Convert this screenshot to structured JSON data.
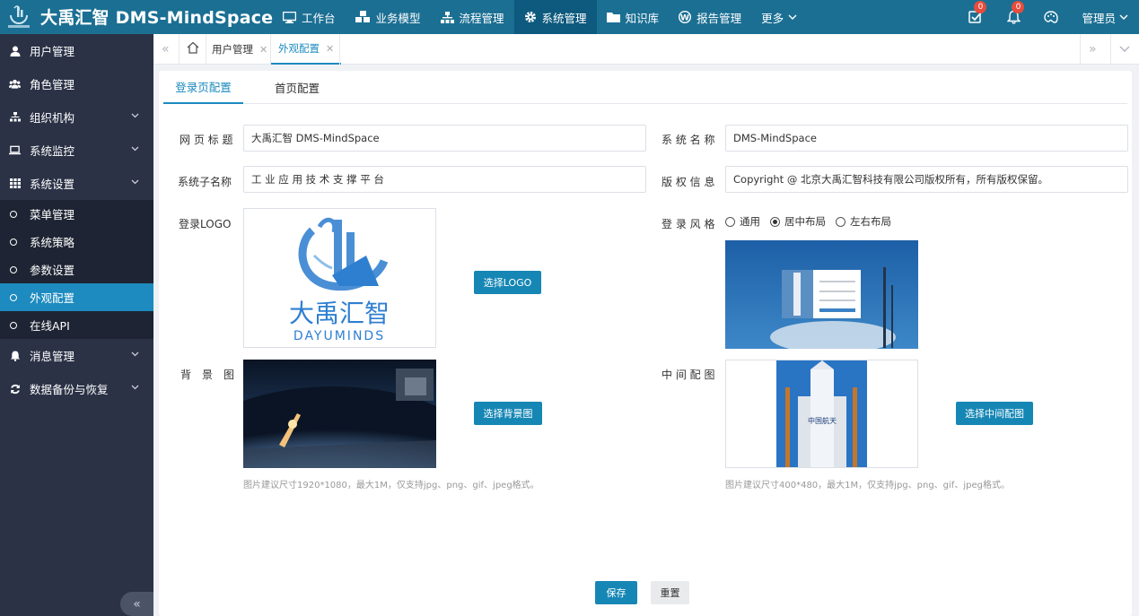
{
  "app": {
    "title": "大禹汇智 DMS-MindSpace",
    "logo_text": "大禹汇智"
  },
  "nav": [
    {
      "label": "工作台",
      "icon": "monitor-icon"
    },
    {
      "label": "业务模型",
      "icon": "cubes-icon"
    },
    {
      "label": "流程管理",
      "icon": "sitemap-icon"
    },
    {
      "label": "系统管理",
      "icon": "gear-icon",
      "active": true
    },
    {
      "label": "知识库",
      "icon": "folder-icon"
    },
    {
      "label": "报告管理",
      "icon": "wordpress-icon"
    },
    {
      "label": "更多",
      "icon": "chevron-down-icon"
    }
  ],
  "topbar": {
    "tasks_badge": "0",
    "notify_badge": "0",
    "user": "管理员"
  },
  "sidebar": {
    "items": [
      {
        "label": "用户管理",
        "icon": "user-icon"
      },
      {
        "label": "角色管理",
        "icon": "users-icon"
      },
      {
        "label": "组织机构",
        "icon": "sitemap-icon",
        "expandable": true
      },
      {
        "label": "系统监控",
        "icon": "laptop-icon",
        "expandable": true
      },
      {
        "label": "系统设置",
        "icon": "grid-icon",
        "expandable": true
      }
    ],
    "sub": [
      {
        "label": "菜单管理"
      },
      {
        "label": "系统策略"
      },
      {
        "label": "参数设置"
      },
      {
        "label": "外观配置",
        "active": true
      },
      {
        "label": "在线API"
      }
    ],
    "after": [
      {
        "label": "消息管理",
        "icon": "bell-icon",
        "expandable": true
      },
      {
        "label": "数据备份与恢复",
        "icon": "refresh-icon",
        "expandable": true
      }
    ],
    "collapse": "«"
  },
  "tabs": [
    {
      "label": "用户管理"
    },
    {
      "label": "外观配置",
      "active": true
    }
  ],
  "subtabs": [
    {
      "label": "登录页配置",
      "active": true
    },
    {
      "label": "首页配置"
    }
  ],
  "form": {
    "web_title_label": "网 页 标 题",
    "web_title_value": "大禹汇智 DMS-MindSpace",
    "sys_name_label": "系 统 名 称",
    "sys_name_value": "DMS-MindSpace",
    "sub_name_label": "系统子名称",
    "sub_name_value": "工 业 应 用 技 术 支 撑 平 台",
    "copyright_label": "版 权 信 息",
    "copyright_value": "Copyright @ 北京大禹汇智科技有限公司版权所有，所有版权保留。",
    "logo_label": "登录LOGO",
    "logo_brand": "大禹汇智",
    "logo_en": "DAYUMINDS",
    "logo_button": "选择LOGO",
    "style_label": "登 录 风 格",
    "style_options": [
      "通用",
      "居中布局",
      "左右布局"
    ],
    "style_selected": "居中布局",
    "bg_label": "背　景　图",
    "bg_button": "选择背景图",
    "bg_hint": "图片建议尺寸1920*1080，最大1M，仅支持jpg、png、gif、jpeg格式。",
    "mid_label": "中 间 配 图",
    "mid_button": "选择中间配图",
    "mid_hint": "图片建议尺寸400*480，最大1M，仅支持jpg、png、gif、jpeg格式。",
    "rocket_text": "中国航天"
  },
  "actions": {
    "save": "保存",
    "reset": "重置"
  },
  "colors": {
    "topbar": "#1b6f93",
    "sidebar": "#2b3246",
    "accent": "#1d8bbf",
    "button": "#1687b5"
  }
}
